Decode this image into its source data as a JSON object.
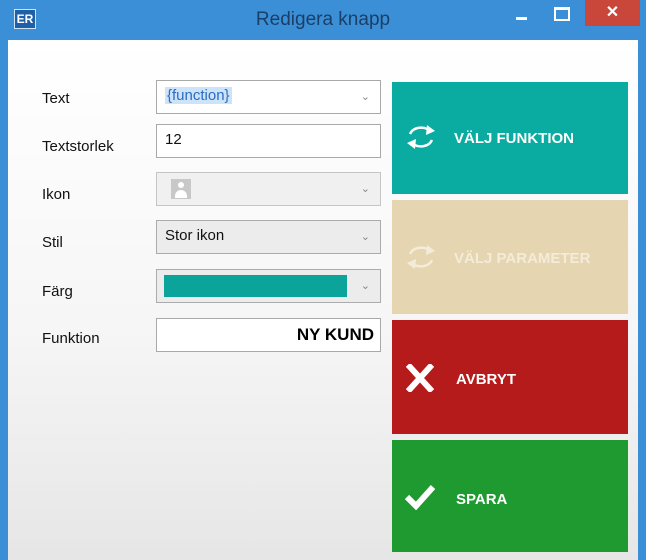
{
  "window": {
    "app_icon_text": "ER",
    "title": "Redigera knapp",
    "close_glyph": "✕",
    "minimize_icon": "minimize-icon",
    "maximize_icon": "maximize-icon"
  },
  "form": {
    "text": {
      "label": "Text",
      "value": "{function}"
    },
    "text_size": {
      "label": "Textstorlek",
      "value": "12"
    },
    "icon": {
      "label": "Ikon",
      "value_icon": "user-placeholder-icon"
    },
    "style": {
      "label": "Stil",
      "value": "Stor ikon"
    },
    "color": {
      "label": "Färg",
      "value": "#0aa49b"
    },
    "function": {
      "label": "Funktion",
      "value": "NY KUND"
    }
  },
  "actions": {
    "choose_function": {
      "label": "VÄLJ FUNKTION",
      "color": "#0aaba0",
      "icon": "swap-arrows-icon"
    },
    "choose_parameter": {
      "label": "VÄLJ PARAMETER",
      "color": "#e5d5b0",
      "icon": "swap-arrows-icon"
    },
    "cancel": {
      "label": "AVBRYT",
      "color": "#b51b1b",
      "icon": "x-icon"
    },
    "save": {
      "label": "SPARA",
      "color": "#1e9a30",
      "icon": "checkmark-icon"
    }
  },
  "colors": {
    "title_bar": "#3a8fd6",
    "close_button": "#c9473a"
  }
}
